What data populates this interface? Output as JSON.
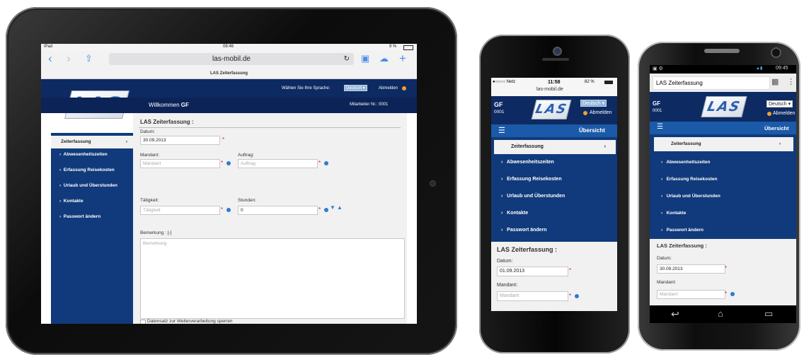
{
  "ipad": {
    "status": {
      "device": "iPad",
      "time": "08:46",
      "battery": "9 %"
    },
    "url": "las-mobil.de",
    "page_title": "LAS Zeiterfassung",
    "language_label": "Wählen Sie Ihre Sprache:",
    "language": "Deutsch",
    "logout": "Abmelden",
    "logo": "LAS",
    "welcome_prefix": "Willkommen",
    "welcome_user": "GF",
    "employee": "Mitarbeiter Nr.: 0001",
    "menu": [
      "Zeiterfassung",
      "Abwesenheitszeiten",
      "Erfassung Reisekosten",
      "Urlaub und Überstunden",
      "Kontakte",
      "Passwort ändern"
    ],
    "form": {
      "title": "LAS Zeiterfassung :",
      "date_label": "Datum:",
      "date_value": "30.09.2013",
      "mandant_label": "Mandant:",
      "mandant_placeholder": "Mandant",
      "auftrag_label": "Auftrag:",
      "auftrag_placeholder": "Auftrag",
      "taetigkeit_label": "Tätigkeit:",
      "taetigkeit_placeholder": "Tätigkeit",
      "stunden_label": "Stunden:",
      "stunden_value": "0",
      "bemerkung_label": "Bemerkung : [-]",
      "bemerkung_placeholder": "Bemerkung",
      "lock_label": "Datensatz zur Weiterverarbeitung sperren"
    }
  },
  "iphone": {
    "status": {
      "carrier": "Netz",
      "time": "11:58",
      "battery": "82 %"
    },
    "url": "las-mobil.de",
    "user": "GF",
    "user_id": "0001",
    "logo": "LAS",
    "language": "Deutsch",
    "logout": "Abmelden",
    "overview": "Übersicht",
    "menu": [
      "Zeiterfassung",
      "Abwesenheitszeiten",
      "Erfassung Reisekosten",
      "Urlaub und Überstunden",
      "Kontakte",
      "Passwort ändern"
    ],
    "form_title": "LAS Zeiterfassung :",
    "date_label": "Datum:",
    "date_value": "01.09.2013",
    "mandant_label": "Mandant:",
    "mandant_placeholder": "Mandant"
  },
  "android": {
    "status": {
      "time": "09:45"
    },
    "tab_title": "LAS Zeiterfassung",
    "user": "GF",
    "user_id": "0001",
    "logo": "LAS",
    "language": "Deutsch",
    "logout": "Abmelden",
    "overview": "Übersicht",
    "menu": [
      "Zeiterfassung",
      "Abwesenheitszeiten",
      "Erfassung Reisekosten",
      "Urlaub und Überstunden",
      "Kontakte",
      "Passwort ändern"
    ],
    "form_title": "LAS Zeiterfassung :",
    "date_label": "Datum:",
    "date_value": "30.09.2013",
    "mandant_label": "Mandant:",
    "mandant_placeholder": "Mandant"
  },
  "colors": {
    "navy": "#0d2a63",
    "menu_blue": "#103a7b",
    "bar_blue": "#1a5aa8",
    "accent_orange": "#f0a030",
    "required_red": "#d22222",
    "help_blue": "#2e7bd1"
  }
}
